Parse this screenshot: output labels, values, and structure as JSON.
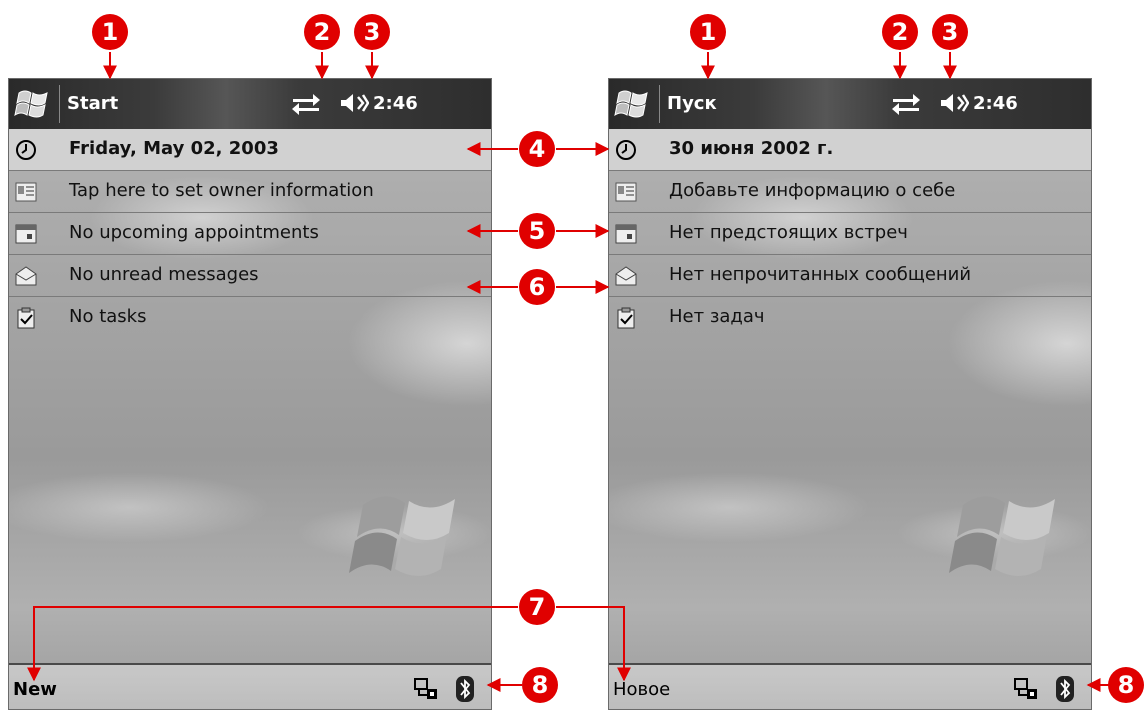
{
  "panels": [
    {
      "start_label": "Start",
      "time": "2:46",
      "rows": [
        "Friday, May 02, 2003",
        "Tap here to set owner information",
        "No upcoming appointments",
        "No unread messages",
        "No tasks"
      ],
      "softkey": "New"
    },
    {
      "start_label": "Пуск",
      "time": "2:46",
      "rows": [
        "30 июня 2002 г.",
        "Добавьте информацию о себе",
        "Нет предстоящих встреч",
        "Нет непрочитанных сообщений",
        "Нет задач"
      ],
      "softkey": "Новое"
    }
  ],
  "callouts": [
    "1",
    "2",
    "3",
    "4",
    "5",
    "6",
    "7",
    "8"
  ],
  "row_icons": [
    "clock-icon",
    "owner-card-icon",
    "calendar-icon",
    "envelope-icon",
    "tasks-icon"
  ],
  "titlebar_icons": [
    "windows-flag-icon",
    "connectivity-icon",
    "speaker-icon"
  ],
  "bottombar_icons": [
    "sync-icon",
    "bluetooth-icon"
  ],
  "colors": {
    "callout": "#e00000",
    "titlebar": "#333333"
  }
}
